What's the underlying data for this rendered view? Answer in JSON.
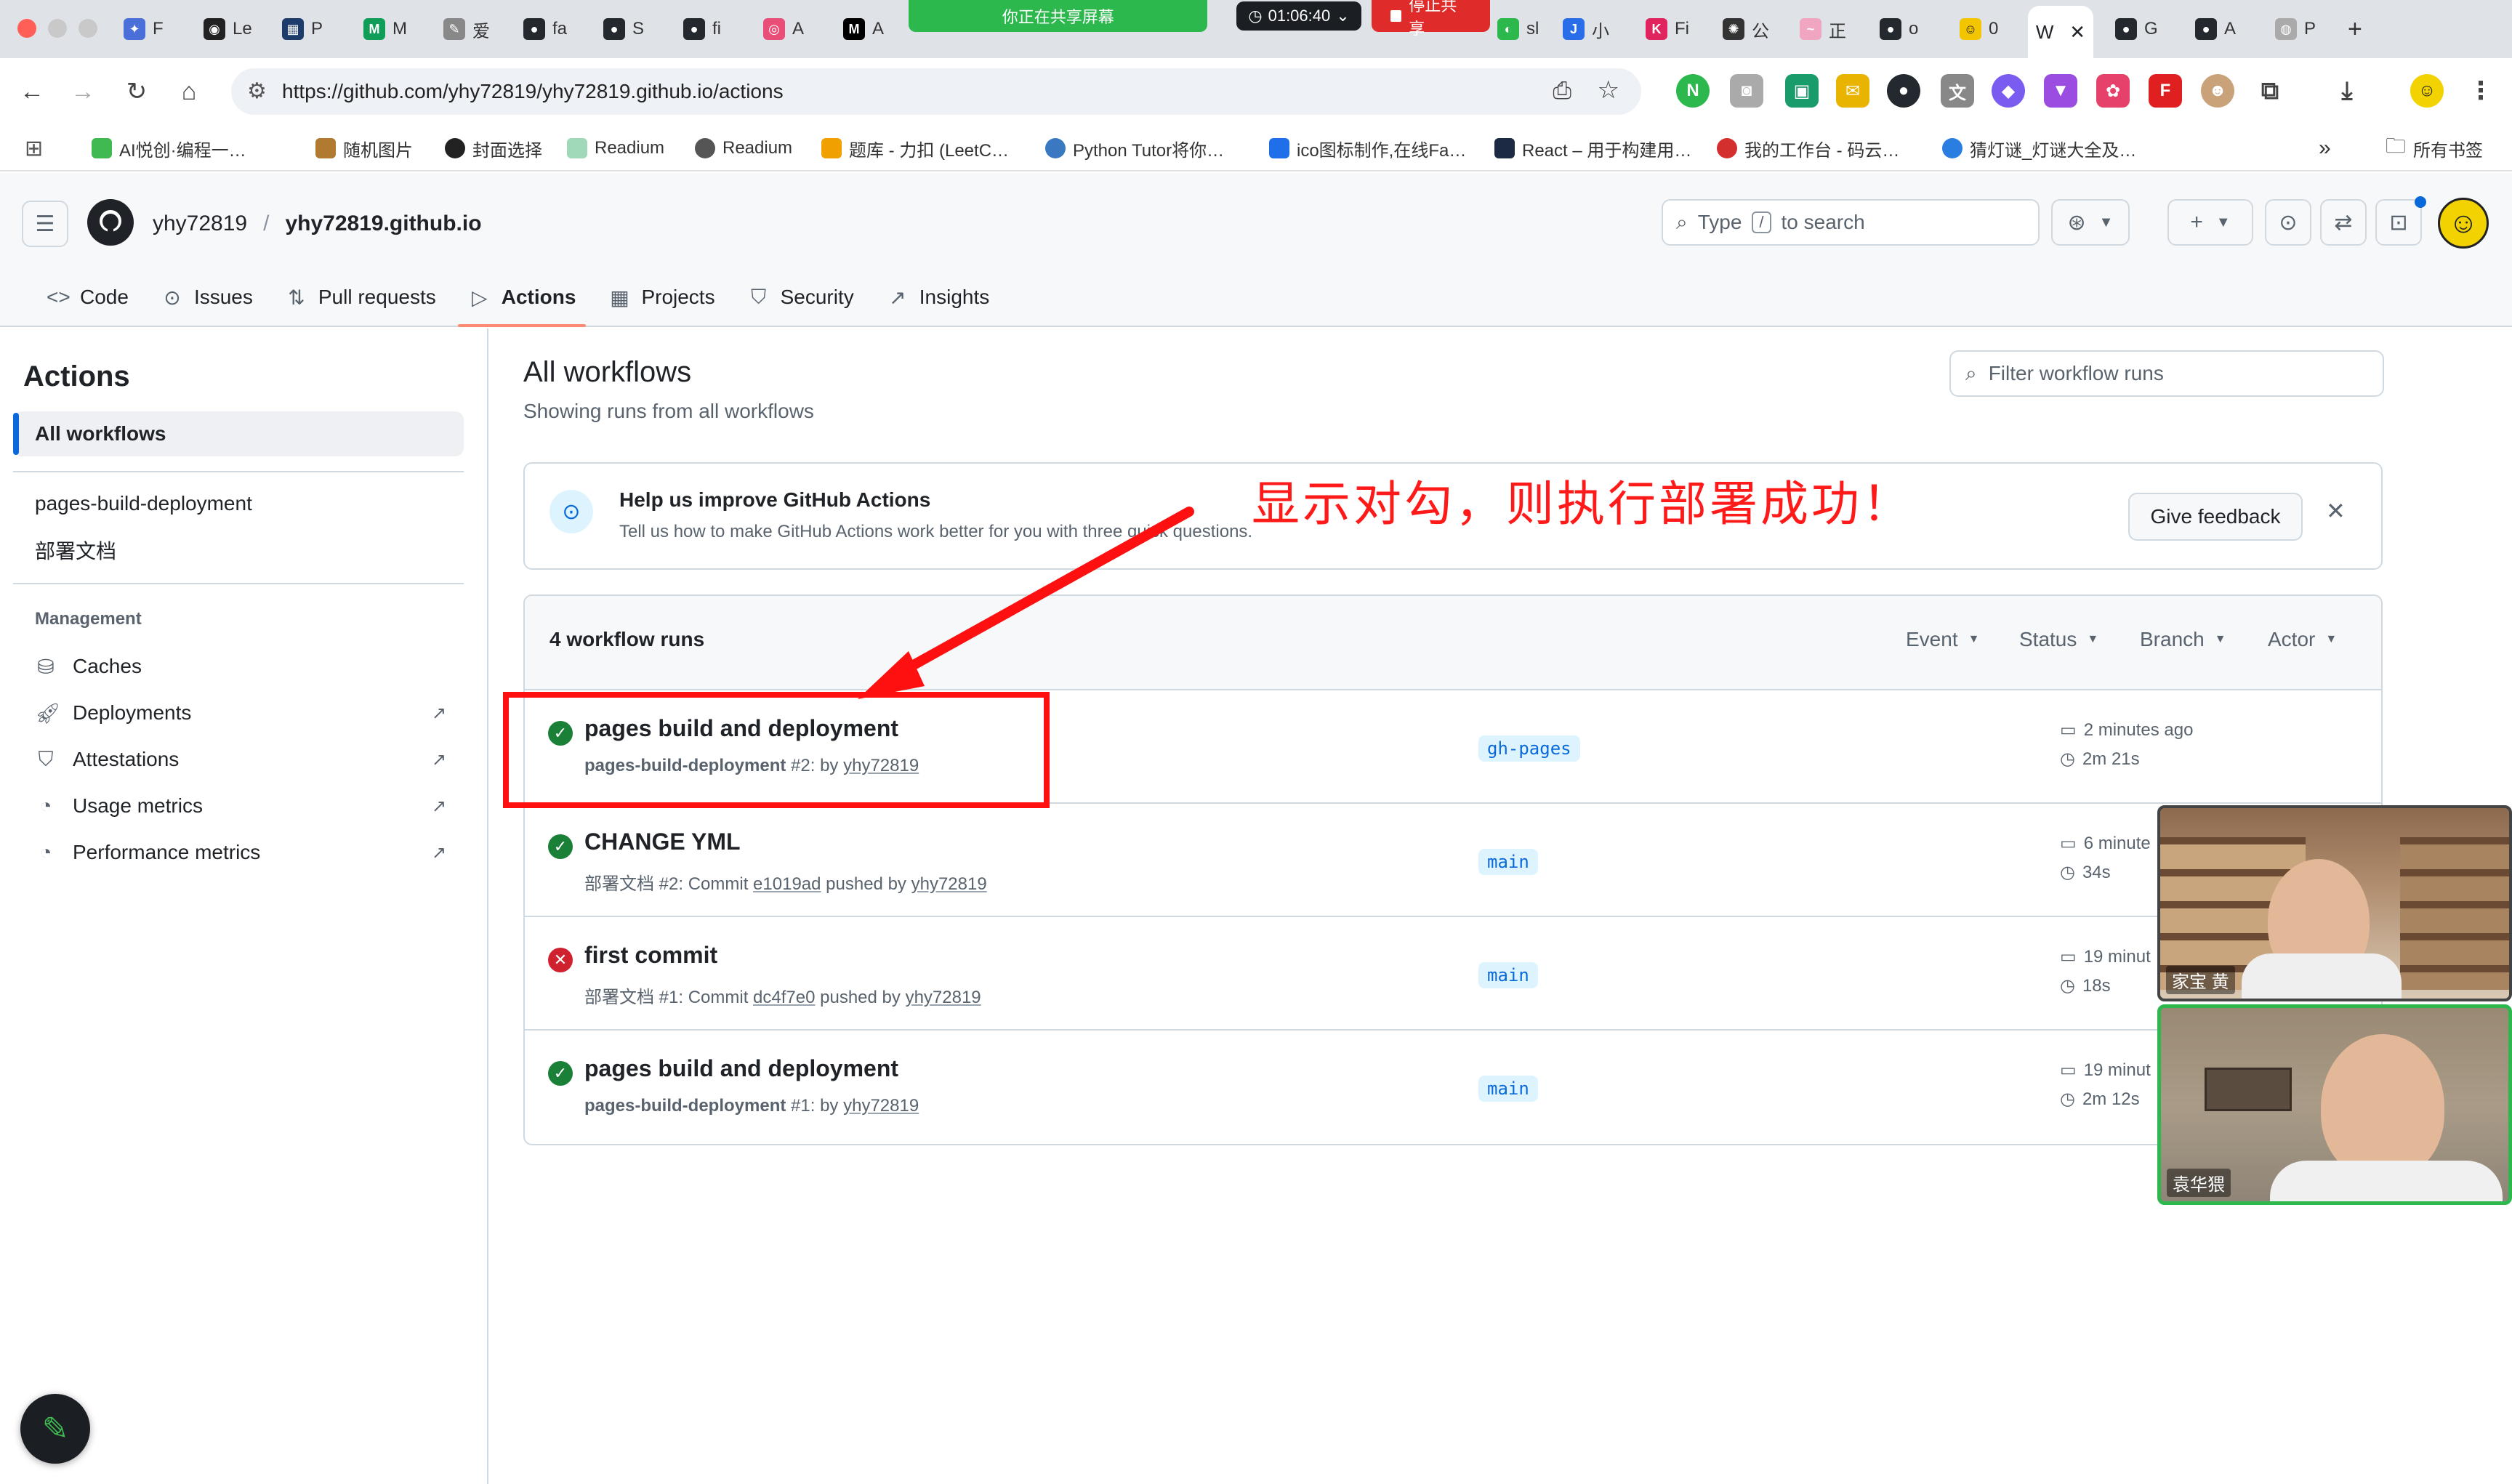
{
  "browser": {
    "url": "https://github.com/yhy72819/yhy72819.github.io/actions",
    "tabs": [
      "F",
      "Le",
      "P",
      "M",
      "爱",
      "fa",
      "S",
      "fi",
      "A",
      "A",
      "sl",
      "小",
      "Fi",
      "公",
      "正",
      "o",
      "0",
      "W",
      "G",
      "A",
      "P"
    ],
    "active_tab_label": "W",
    "share_bar": {
      "sharing_text": "你正在共享屏幕",
      "timer": "01:06:40",
      "stop_label": "停止共享"
    },
    "bookmarks": [
      "AI悦创·编程一…",
      "随机图片",
      "封面选择",
      "Readium",
      "Readium",
      "题库 - 力扣 (LeetC…",
      "Python Tutor将你…",
      "ico图标制作,在线Fa…",
      "React – 用于构建用…",
      "我的工作台 - 码云…",
      "猜灯谜_灯谜大全及…",
      "所有书签"
    ],
    "more_bookmarks": "»"
  },
  "header": {
    "owner": "yhy72819",
    "separator": "/",
    "repo": "yhy72819.github.io",
    "search_placeholder": "Type / to search",
    "search_type": "Type",
    "search_slash": "/",
    "search_rest": "to search"
  },
  "repo_nav": [
    {
      "label": "Code",
      "icon": "code-icon"
    },
    {
      "label": "Issues",
      "icon": "issue-icon"
    },
    {
      "label": "Pull requests",
      "icon": "pull-request-icon"
    },
    {
      "label": "Actions",
      "icon": "play-icon",
      "active": true
    },
    {
      "label": "Projects",
      "icon": "table-icon"
    },
    {
      "label": "Security",
      "icon": "shield-icon"
    },
    {
      "label": "Insights",
      "icon": "graph-icon"
    }
  ],
  "sidebar": {
    "title": "Actions",
    "all_workflows": "All workflows",
    "workflows": [
      "pages-build-deployment",
      "部署文档"
    ],
    "management_heading": "Management",
    "management": [
      "Caches",
      "Deployments",
      "Attestations",
      "Usage metrics",
      "Performance metrics"
    ]
  },
  "main": {
    "title": "All workflows",
    "subtitle": "Showing runs from all workflows",
    "filter_placeholder": "Filter workflow runs",
    "feedback": {
      "title": "Help us improve GitHub Actions",
      "body": "Tell us how to make GitHub Actions work better for you with three quick questions.",
      "button": "Give feedback"
    },
    "runs_count": "4 workflow runs",
    "filters": [
      "Event",
      "Status",
      "Branch",
      "Actor"
    ],
    "runs": [
      {
        "status": "success",
        "title": "pages build and deployment",
        "sub_workflow": "pages-build-deployment",
        "sub_rest": "#2: by",
        "commit": "",
        "pushed": "",
        "user": "yhy72819",
        "branch": "gh-pages",
        "time": "2 minutes ago",
        "duration": "2m 21s"
      },
      {
        "status": "success",
        "title": "CHANGE YML",
        "sub_workflow": "部署文档",
        "sub_rest": "#2: Commit",
        "commit": "e1019ad",
        "pushed": "pushed by",
        "user": "yhy72819",
        "branch": "main",
        "time": "6 minute",
        "duration": "34s"
      },
      {
        "status": "failure",
        "title": "first commit",
        "sub_workflow": "部署文档",
        "sub_rest": "#1: Commit",
        "commit": "dc4f7e0",
        "pushed": "pushed by",
        "user": "yhy72819",
        "branch": "main",
        "time": "19 minut",
        "duration": "18s"
      },
      {
        "status": "success",
        "title": "pages build and deployment",
        "sub_workflow": "pages-build-deployment",
        "sub_rest": "#1: by",
        "commit": "",
        "pushed": "",
        "user": "yhy72819",
        "branch": "main",
        "time": "19 minut",
        "duration": "2m 12s"
      }
    ]
  },
  "annotation": {
    "text": "显示对勾，则执行部署成功！",
    "color": "#ff1a1a"
  },
  "video_call": {
    "participants": [
      "家宝 黄",
      "袁华猥"
    ]
  },
  "colors": {
    "success": "#1a7f37",
    "failure": "#cf222e",
    "accent_link": "#0969da",
    "active_tab_underline": "#fd8c73"
  }
}
